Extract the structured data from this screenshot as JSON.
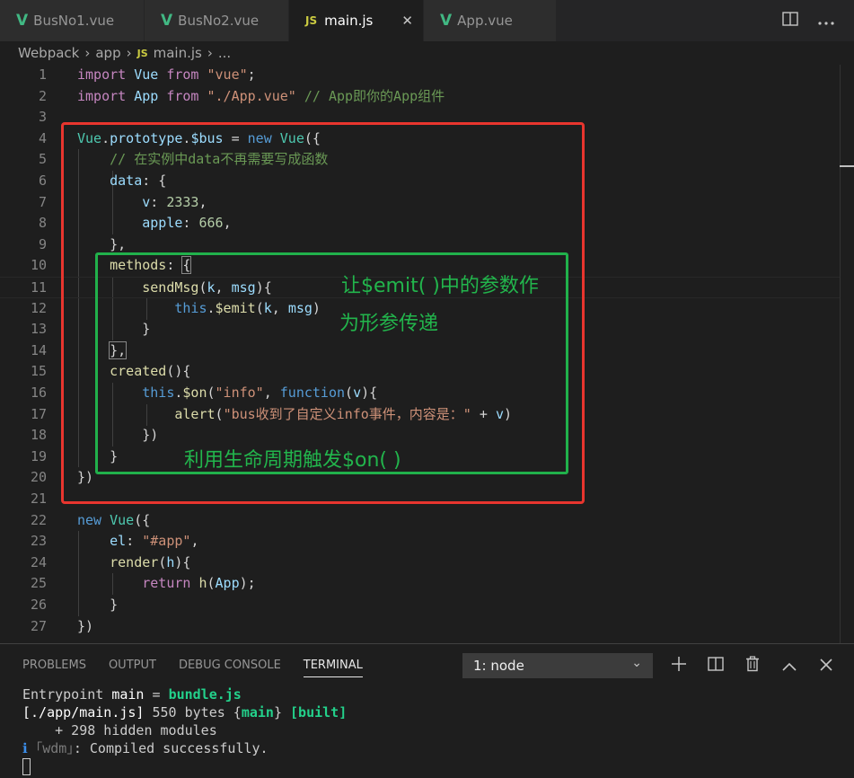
{
  "tabs": [
    {
      "label": "BusNo1.vue",
      "icon": "vue-file-icon"
    },
    {
      "label": "BusNo2.vue",
      "icon": "vue-file-icon"
    },
    {
      "label": "main.js",
      "icon": "js-file-icon",
      "active": true,
      "close": "✕"
    },
    {
      "label": "App.vue",
      "icon": "vue-file-icon"
    }
  ],
  "icon_glyphs": {
    "vue": "V",
    "js": "JS"
  },
  "breadcrumb": {
    "folder1": "Webpack",
    "folder2": "app",
    "file": "main.js",
    "more": "..."
  },
  "line_numbers": [
    "1",
    "2",
    "3",
    "4",
    "5",
    "6",
    "7",
    "8",
    "9",
    "10",
    "11",
    "12",
    "13",
    "14",
    "15",
    "16",
    "17",
    "18",
    "19",
    "20",
    "21",
    "22",
    "23",
    "24",
    "25",
    "26",
    "27"
  ],
  "code": {
    "l1": [
      "import",
      "Vue",
      "from",
      "\"vue\"",
      ";"
    ],
    "l2": [
      "import",
      "App",
      "from",
      "\"./App.vue\"",
      "// App即你的App组件"
    ],
    "l4": [
      "Vue",
      ".",
      "prototype",
      ".",
      "$bus",
      " = ",
      "new",
      " ",
      "Vue",
      "({"
    ],
    "l5": "// 在实例中data不再需要写成函数",
    "l6": [
      "data",
      ": {"
    ],
    "l7": [
      "v",
      ": ",
      "2333",
      ","
    ],
    "l8": [
      "apple",
      ": ",
      "666",
      ","
    ],
    "l9": "},",
    "l10": [
      "methods",
      ": ",
      "{"
    ],
    "l11": [
      "sendMsg",
      "(",
      "k",
      ", ",
      "msg",
      "){"
    ],
    "l12": [
      "this",
      ".",
      "$emit",
      "(",
      "k",
      ", ",
      "msg",
      ")"
    ],
    "l13": "}",
    "l14": "},",
    "l15": [
      "created",
      "(){"
    ],
    "l16": [
      "this",
      ".",
      "$on",
      "(",
      "\"info\"",
      ", ",
      "function",
      "(",
      "v",
      "){"
    ],
    "l17": [
      "alert",
      "(",
      "\"bus收到了自定义info事件，内容是：\"",
      " + ",
      "v",
      ")"
    ],
    "l18": "})",
    "l19": "}",
    "l20": "})",
    "l22": [
      "new",
      " ",
      "Vue",
      "({"
    ],
    "l23": [
      "el",
      ": ",
      "\"#app\"",
      ","
    ],
    "l24": [
      "render",
      "(",
      "h",
      "){"
    ],
    "l25": [
      "return",
      " ",
      "h",
      "(",
      "App",
      ");"
    ],
    "l26": "}",
    "l27": "})"
  },
  "annotations": {
    "emit_note_line1": "让$emit( )中的参数作",
    "emit_note_line2": "为形参传递",
    "on_note": "利用生命周期触发$on( )"
  },
  "panel": {
    "tabs": [
      "PROBLEMS",
      "OUTPUT",
      "DEBUG CONSOLE",
      "TERMINAL"
    ],
    "active_tab": "TERMINAL",
    "terminal_select": "1: node",
    "actions": [
      "add-icon",
      "split-icon",
      "trash-icon",
      "chevron-up-icon",
      "close-icon"
    ]
  },
  "terminal": {
    "l1_a": "Entrypoint ",
    "l1_b": "main",
    "l1_c": " = ",
    "l1_d": "bundle.js",
    "l2_a": "[./app/main.js]",
    "l2_b": " 550 bytes {",
    "l2_c": "main",
    "l2_d": "} ",
    "l2_e": "[built]",
    "l3": "    + 298 hidden modules",
    "l4_a": "ℹ",
    "l4_b": " ｢wdm｣",
    "l4_c": ": Compiled successfully."
  },
  "colors": {
    "red_box": "#e8352e",
    "green_box": "#21b14b",
    "vue_green": "#41b883",
    "js_yellow": "#cbcb41"
  }
}
